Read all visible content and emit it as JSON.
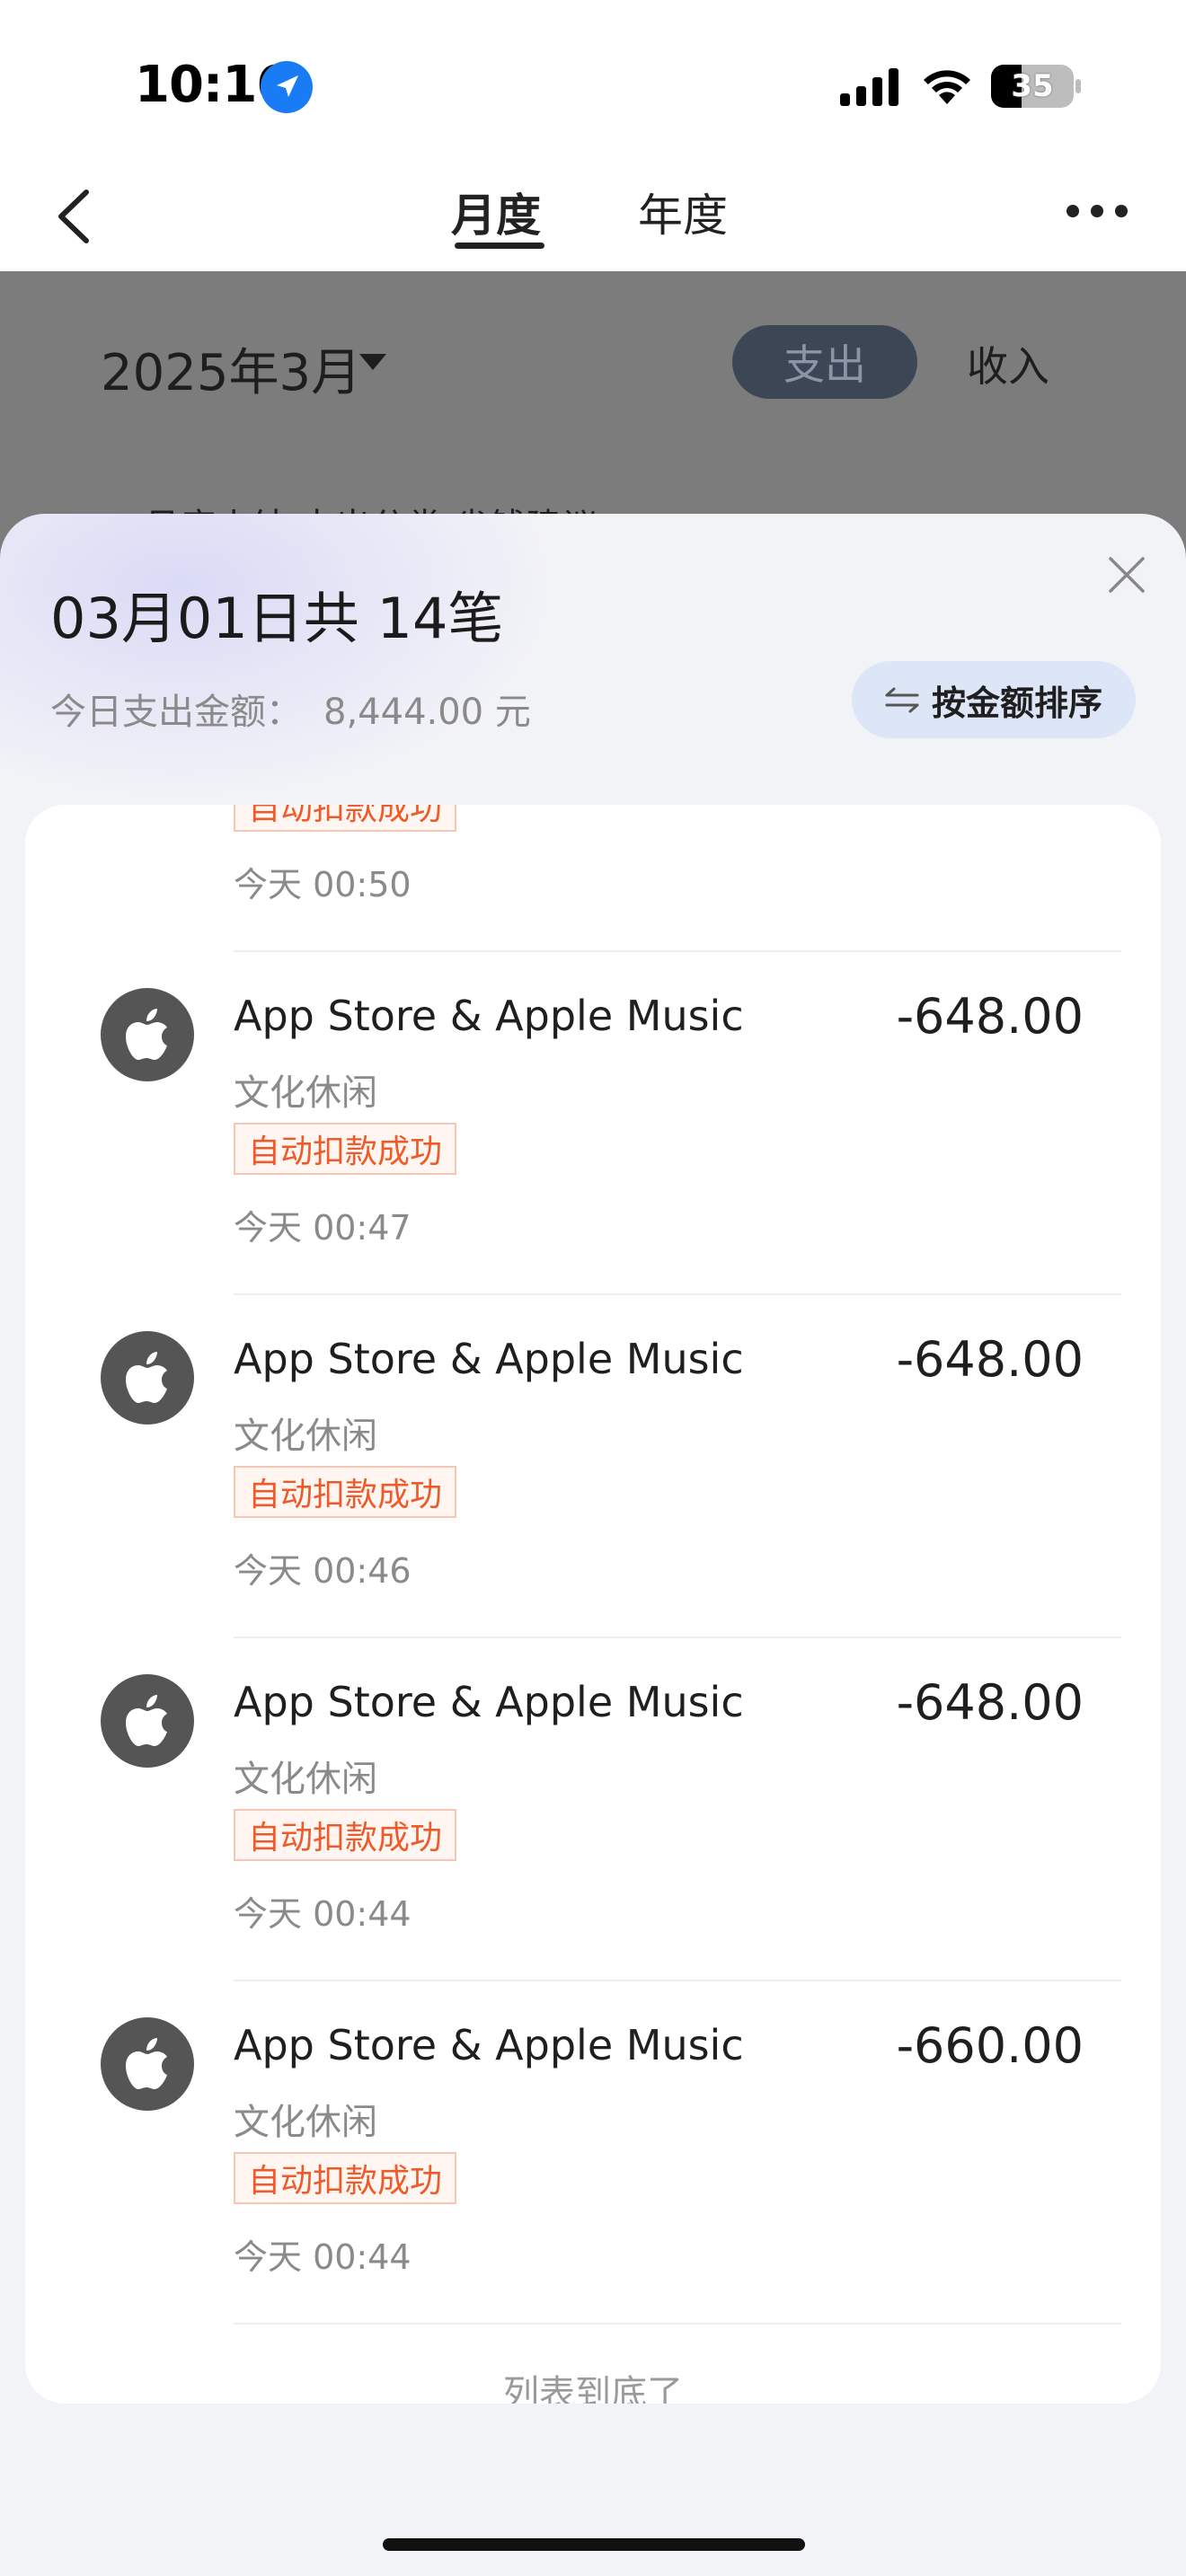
{
  "status_bar": {
    "time": "10:16",
    "battery": "35"
  },
  "nav": {
    "tabs": [
      {
        "label": "月度",
        "active": true
      },
      {
        "label": "年度",
        "active": false
      }
    ]
  },
  "background": {
    "month": "2025年3月",
    "expense_label": "支出",
    "income_label": "收入",
    "subtabs": "月度小结          支出分类          省钱建议"
  },
  "sheet": {
    "title": "03月01日共 14笔",
    "total_label": "今日支出金额：",
    "total_value": "8,444.00 元",
    "sort_label": "按金额排序",
    "accent_color": "#ee5a2a"
  },
  "transactions": [
    {
      "name": "",
      "category": "",
      "status": "自动扣款成功",
      "time": "今天 00:50",
      "amount": ""
    },
    {
      "name": "App Store & Apple Music",
      "category": "文化休闲",
      "status": "自动扣款成功",
      "time": "今天 00:47",
      "amount": "-648.00"
    },
    {
      "name": "App Store & Apple Music",
      "category": "文化休闲",
      "status": "自动扣款成功",
      "time": "今天 00:46",
      "amount": "-648.00"
    },
    {
      "name": "App Store & Apple Music",
      "category": "文化休闲",
      "status": "自动扣款成功",
      "time": "今天 00:44",
      "amount": "-648.00"
    },
    {
      "name": "App Store & Apple Music",
      "category": "文化休闲",
      "status": "自动扣款成功",
      "time": "今天 00:44",
      "amount": "-660.00"
    }
  ],
  "list_end": "列表到底了"
}
